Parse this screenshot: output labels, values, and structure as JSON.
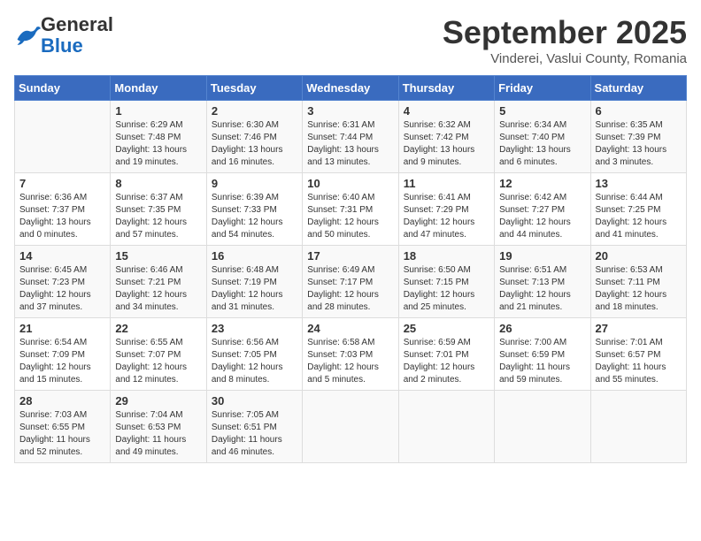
{
  "header": {
    "logo": {
      "general": "General",
      "blue": "Blue"
    },
    "title": "September 2025",
    "subtitle": "Vinderei, Vaslui County, Romania"
  },
  "weekdays": [
    "Sunday",
    "Monday",
    "Tuesday",
    "Wednesday",
    "Thursday",
    "Friday",
    "Saturday"
  ],
  "weeks": [
    [
      {
        "day": "",
        "sunrise": "",
        "sunset": "",
        "daylight": ""
      },
      {
        "day": "1",
        "sunrise": "Sunrise: 6:29 AM",
        "sunset": "Sunset: 7:48 PM",
        "daylight": "Daylight: 13 hours and 19 minutes."
      },
      {
        "day": "2",
        "sunrise": "Sunrise: 6:30 AM",
        "sunset": "Sunset: 7:46 PM",
        "daylight": "Daylight: 13 hours and 16 minutes."
      },
      {
        "day": "3",
        "sunrise": "Sunrise: 6:31 AM",
        "sunset": "Sunset: 7:44 PM",
        "daylight": "Daylight: 13 hours and 13 minutes."
      },
      {
        "day": "4",
        "sunrise": "Sunrise: 6:32 AM",
        "sunset": "Sunset: 7:42 PM",
        "daylight": "Daylight: 13 hours and 9 minutes."
      },
      {
        "day": "5",
        "sunrise": "Sunrise: 6:34 AM",
        "sunset": "Sunset: 7:40 PM",
        "daylight": "Daylight: 13 hours and 6 minutes."
      },
      {
        "day": "6",
        "sunrise": "Sunrise: 6:35 AM",
        "sunset": "Sunset: 7:39 PM",
        "daylight": "Daylight: 13 hours and 3 minutes."
      }
    ],
    [
      {
        "day": "7",
        "sunrise": "Sunrise: 6:36 AM",
        "sunset": "Sunset: 7:37 PM",
        "daylight": "Daylight: 13 hours and 0 minutes."
      },
      {
        "day": "8",
        "sunrise": "Sunrise: 6:37 AM",
        "sunset": "Sunset: 7:35 PM",
        "daylight": "Daylight: 12 hours and 57 minutes."
      },
      {
        "day": "9",
        "sunrise": "Sunrise: 6:39 AM",
        "sunset": "Sunset: 7:33 PM",
        "daylight": "Daylight: 12 hours and 54 minutes."
      },
      {
        "day": "10",
        "sunrise": "Sunrise: 6:40 AM",
        "sunset": "Sunset: 7:31 PM",
        "daylight": "Daylight: 12 hours and 50 minutes."
      },
      {
        "day": "11",
        "sunrise": "Sunrise: 6:41 AM",
        "sunset": "Sunset: 7:29 PM",
        "daylight": "Daylight: 12 hours and 47 minutes."
      },
      {
        "day": "12",
        "sunrise": "Sunrise: 6:42 AM",
        "sunset": "Sunset: 7:27 PM",
        "daylight": "Daylight: 12 hours and 44 minutes."
      },
      {
        "day": "13",
        "sunrise": "Sunrise: 6:44 AM",
        "sunset": "Sunset: 7:25 PM",
        "daylight": "Daylight: 12 hours and 41 minutes."
      }
    ],
    [
      {
        "day": "14",
        "sunrise": "Sunrise: 6:45 AM",
        "sunset": "Sunset: 7:23 PM",
        "daylight": "Daylight: 12 hours and 37 minutes."
      },
      {
        "day": "15",
        "sunrise": "Sunrise: 6:46 AM",
        "sunset": "Sunset: 7:21 PM",
        "daylight": "Daylight: 12 hours and 34 minutes."
      },
      {
        "day": "16",
        "sunrise": "Sunrise: 6:48 AM",
        "sunset": "Sunset: 7:19 PM",
        "daylight": "Daylight: 12 hours and 31 minutes."
      },
      {
        "day": "17",
        "sunrise": "Sunrise: 6:49 AM",
        "sunset": "Sunset: 7:17 PM",
        "daylight": "Daylight: 12 hours and 28 minutes."
      },
      {
        "day": "18",
        "sunrise": "Sunrise: 6:50 AM",
        "sunset": "Sunset: 7:15 PM",
        "daylight": "Daylight: 12 hours and 25 minutes."
      },
      {
        "day": "19",
        "sunrise": "Sunrise: 6:51 AM",
        "sunset": "Sunset: 7:13 PM",
        "daylight": "Daylight: 12 hours and 21 minutes."
      },
      {
        "day": "20",
        "sunrise": "Sunrise: 6:53 AM",
        "sunset": "Sunset: 7:11 PM",
        "daylight": "Daylight: 12 hours and 18 minutes."
      }
    ],
    [
      {
        "day": "21",
        "sunrise": "Sunrise: 6:54 AM",
        "sunset": "Sunset: 7:09 PM",
        "daylight": "Daylight: 12 hours and 15 minutes."
      },
      {
        "day": "22",
        "sunrise": "Sunrise: 6:55 AM",
        "sunset": "Sunset: 7:07 PM",
        "daylight": "Daylight: 12 hours and 12 minutes."
      },
      {
        "day": "23",
        "sunrise": "Sunrise: 6:56 AM",
        "sunset": "Sunset: 7:05 PM",
        "daylight": "Daylight: 12 hours and 8 minutes."
      },
      {
        "day": "24",
        "sunrise": "Sunrise: 6:58 AM",
        "sunset": "Sunset: 7:03 PM",
        "daylight": "Daylight: 12 hours and 5 minutes."
      },
      {
        "day": "25",
        "sunrise": "Sunrise: 6:59 AM",
        "sunset": "Sunset: 7:01 PM",
        "daylight": "Daylight: 12 hours and 2 minutes."
      },
      {
        "day": "26",
        "sunrise": "Sunrise: 7:00 AM",
        "sunset": "Sunset: 6:59 PM",
        "daylight": "Daylight: 11 hours and 59 minutes."
      },
      {
        "day": "27",
        "sunrise": "Sunrise: 7:01 AM",
        "sunset": "Sunset: 6:57 PM",
        "daylight": "Daylight: 11 hours and 55 minutes."
      }
    ],
    [
      {
        "day": "28",
        "sunrise": "Sunrise: 7:03 AM",
        "sunset": "Sunset: 6:55 PM",
        "daylight": "Daylight: 11 hours and 52 minutes."
      },
      {
        "day": "29",
        "sunrise": "Sunrise: 7:04 AM",
        "sunset": "Sunset: 6:53 PM",
        "daylight": "Daylight: 11 hours and 49 minutes."
      },
      {
        "day": "30",
        "sunrise": "Sunrise: 7:05 AM",
        "sunset": "Sunset: 6:51 PM",
        "daylight": "Daylight: 11 hours and 46 minutes."
      },
      {
        "day": "",
        "sunrise": "",
        "sunset": "",
        "daylight": ""
      },
      {
        "day": "",
        "sunrise": "",
        "sunset": "",
        "daylight": ""
      },
      {
        "day": "",
        "sunrise": "",
        "sunset": "",
        "daylight": ""
      },
      {
        "day": "",
        "sunrise": "",
        "sunset": "",
        "daylight": ""
      }
    ]
  ]
}
